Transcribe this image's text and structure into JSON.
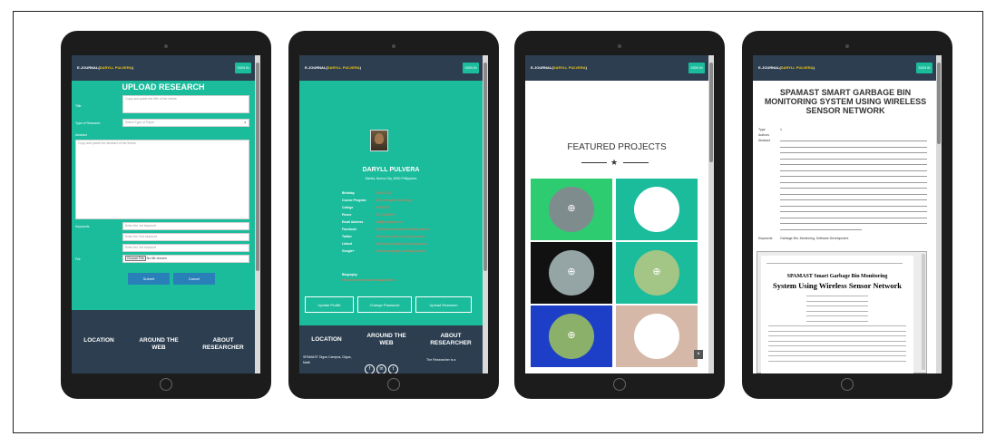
{
  "brand": {
    "prefix": "E-JOURNAL(",
    "name": "DARYLL PULVERA",
    "suffix": ")"
  },
  "topbar_button": "SIGN IN",
  "screen1": {
    "title": "UPLOAD RESEARCH",
    "fields": [
      {
        "label": "Title",
        "value": "Copy and paste the title of the thesis"
      },
      {
        "label": "Type of Research",
        "value": "Select Type of Paper"
      },
      {
        "label": "Abstract",
        "value": "Copy and paste the abstract of the thesis"
      },
      {
        "label": "Keywords",
        "value": "Enter the 1st keyword"
      },
      {
        "label": "",
        "value": "Enter the 2nd keyword"
      },
      {
        "label": "",
        "value": "Enter the 3rd keyword"
      },
      {
        "label": "File",
        "value": "Choose File",
        "note": "No file chosen"
      }
    ],
    "submit": "Submit",
    "cancel": "Cancel",
    "footer": [
      "LOCATION",
      "AROUND THE WEB",
      "ABOUT RESEARCHER"
    ]
  },
  "screen2": {
    "name": "DARYLL PULVERA",
    "address": "Manila, Nueva City, 8000 Philippines",
    "info": [
      {
        "label": "Birthday",
        "value": "2000-01-01"
      },
      {
        "label": "Course Program",
        "value": "BS Information Technology"
      },
      {
        "label": "College",
        "value": "SPAMAST"
      },
      {
        "label": "Phone",
        "value": "09123456789"
      },
      {
        "label": "Email Address",
        "value": "mail@example.com"
      },
      {
        "label": "Facebook",
        "value": "http://www.facebook.com/daryll.pulvera"
      },
      {
        "label": "Twitter",
        "value": "http://www.twitter.com/daryll.pulvera"
      },
      {
        "label": "Linked",
        "value": "http://www.linkedin.com/daryll.pulvera"
      },
      {
        "label": "Google+",
        "value": "http://www.google.com/daryll.pulvera"
      }
    ],
    "biography_label": "Biography",
    "biography_value": "http://www.facebook.com/daryll.pulvera",
    "buttons": [
      "Update Profile",
      "Change Password",
      "Upload Research"
    ],
    "footer": [
      "LOCATION",
      "AROUND THE WEB",
      "ABOUT RESEARCHER"
    ],
    "footer_sub": "SPAMAST Digos Campus, Digos, Matti",
    "footer_sub2": "The Researcher is a"
  },
  "screen3": {
    "title": "FEATURED PROJECTS",
    "tiles": [
      {
        "bg": "#2ecc71",
        "circle": "#7f8c8d"
      },
      {
        "bg": "#1abc9c",
        "circle": "#ffffff"
      },
      {
        "bg": "#111111",
        "circle": "#95a5a6"
      },
      {
        "bg": "#1abc9c",
        "circle": "#a3c585"
      },
      {
        "bg": "#1d3fc8",
        "circle": "#8bb06a"
      },
      {
        "bg": "#d5b8a8",
        "circle": "#ffffff"
      }
    ]
  },
  "screen4": {
    "title": "SPAMAST SMART GARBAGE BIN MONITORING SYSTEM USING WIRELESS SENSOR NETWORK",
    "meta": [
      {
        "label": "Type",
        "value": "1"
      },
      {
        "label": "Authors",
        "value": ""
      },
      {
        "label": "Abstract",
        "value": ""
      }
    ],
    "keywords_label": "Keywords",
    "keywords_value": "Garbage Bin, Monitoring, Software Development",
    "pdf_title_1": "SPAMAST Smart Garbage Bin Monitoring",
    "pdf_title_2": "System Using Wireless Sensor Network"
  }
}
